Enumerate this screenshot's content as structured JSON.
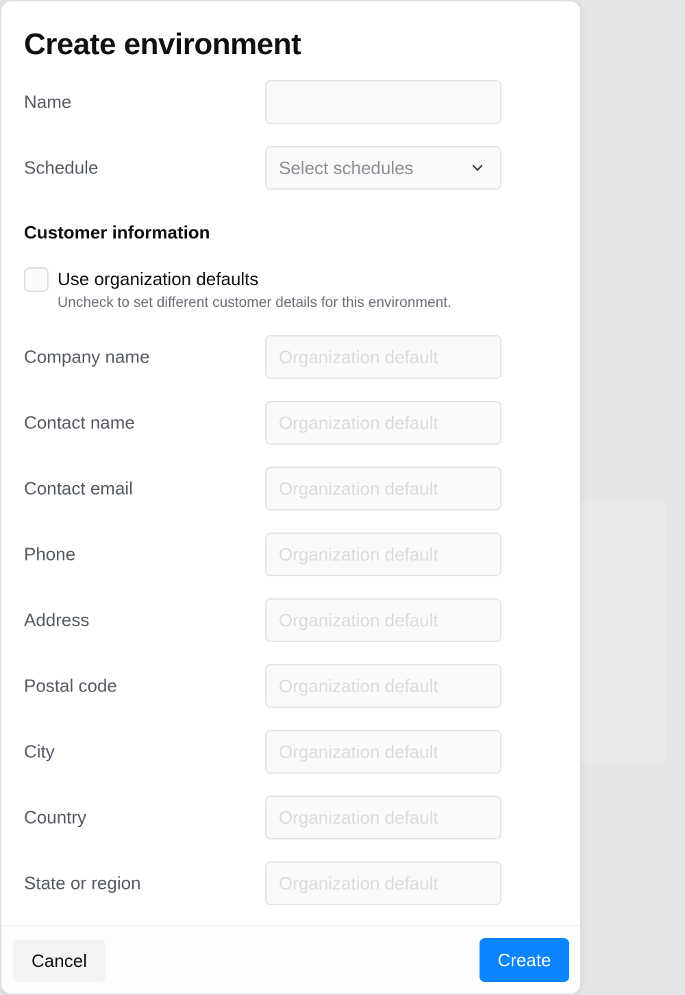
{
  "dialog": {
    "title": "Create environment",
    "name_label": "Name",
    "name_value": "",
    "schedule_label": "Schedule",
    "schedule_placeholder": "Select schedules",
    "customer_section_title": "Customer information",
    "use_defaults": {
      "label": "Use organization defaults",
      "help": "Uncheck to set different customer details for this environment.",
      "checked": false
    },
    "customer_fields": [
      {
        "label": "Company name",
        "placeholder": "Organization default"
      },
      {
        "label": "Contact name",
        "placeholder": "Organization default"
      },
      {
        "label": "Contact email",
        "placeholder": "Organization default"
      },
      {
        "label": "Phone",
        "placeholder": "Organization default"
      },
      {
        "label": "Address",
        "placeholder": "Organization default"
      },
      {
        "label": "Postal code",
        "placeholder": "Organization default"
      },
      {
        "label": "City",
        "placeholder": "Organization default"
      },
      {
        "label": "Country",
        "placeholder": "Organization default"
      },
      {
        "label": "State or region",
        "placeholder": "Organization default"
      }
    ],
    "cancel_label": "Cancel",
    "create_label": "Create"
  },
  "colors": {
    "primary": "#0a84ff",
    "title_text": "#111111",
    "label_text": "#555b63",
    "field_border": "#e4e5e7"
  },
  "icons": {
    "schedule_dropdown": "chevron-down-icon"
  }
}
